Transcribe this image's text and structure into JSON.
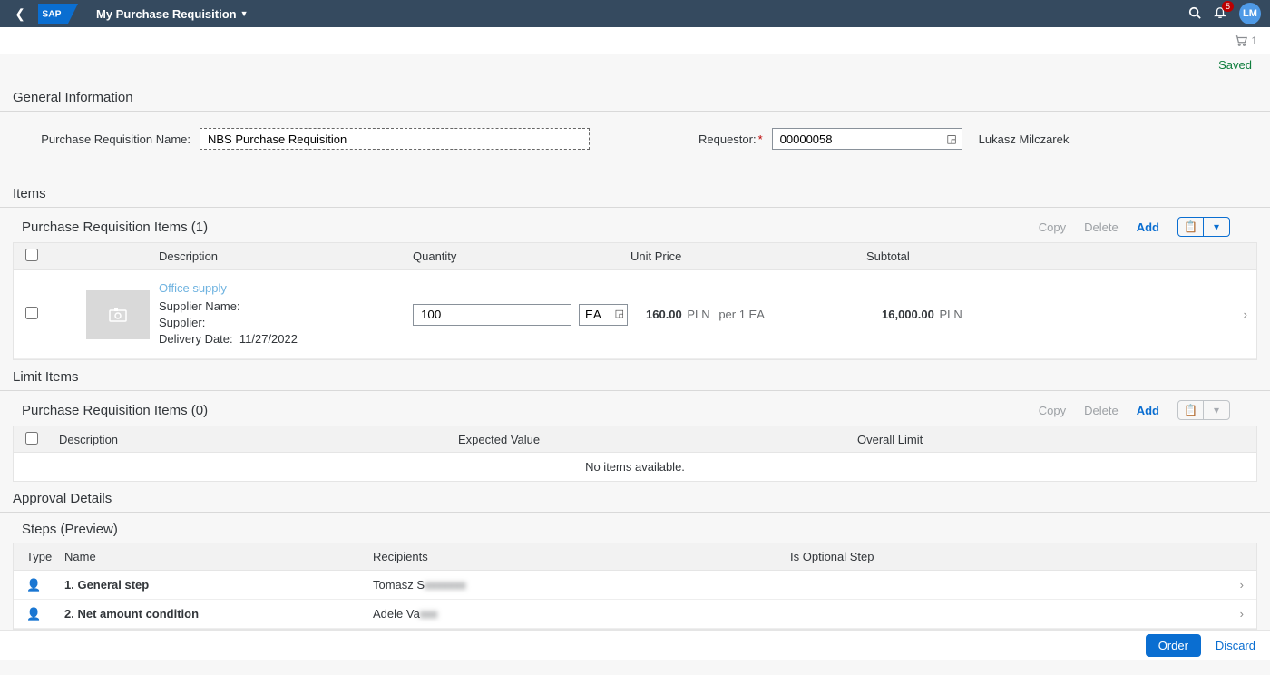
{
  "shell": {
    "app_title": "My Purchase Requisition",
    "notification_count": "5",
    "avatar_initials": "LM",
    "cart_count": "1"
  },
  "status": {
    "saved": "Saved"
  },
  "sections": {
    "general": "General Information",
    "items": "Items",
    "limit": "Limit Items",
    "approval": "Approval Details"
  },
  "general": {
    "pr_name_label": "Purchase Requisition Name:",
    "pr_name_value": "NBS Purchase Requisition",
    "requestor_label": "Requestor:",
    "requestor_value": "00000058",
    "requestor_name": "Lukasz Milczarek"
  },
  "items_panel": {
    "title": "Purchase Requisition Items (1)",
    "copy": "Copy",
    "delete": "Delete",
    "add": "Add",
    "cols": {
      "desc": "Description",
      "qty": "Quantity",
      "unit": "Unit Price",
      "sub": "Subtotal"
    },
    "row": {
      "desc_link": "Office supply",
      "supplier_name_label": "Supplier Name:",
      "supplier_label": "Supplier:",
      "delivery_label": "Delivery Date:",
      "delivery_value": "11/27/2022",
      "qty_value": "100",
      "qty_unit": "EA",
      "price_value": "160.00",
      "price_currency": "PLN",
      "price_per": "per 1 EA",
      "subtotal_value": "16,000.00",
      "subtotal_currency": "PLN"
    }
  },
  "limit_panel": {
    "title": "Purchase Requisition Items (0)",
    "copy": "Copy",
    "delete": "Delete",
    "add": "Add",
    "cols": {
      "desc": "Description",
      "exp": "Expected Value",
      "over": "Overall Limit"
    },
    "empty": "No items available."
  },
  "approval_panel": {
    "title": "Steps (Preview)",
    "cols": {
      "type": "Type",
      "name": "Name",
      "rec": "Recipients",
      "opt": "Is Optional Step"
    },
    "steps": [
      {
        "name": "1. General step",
        "rec_visible": "Tomasz S",
        "rec_blur": "xxxxxxx"
      },
      {
        "name": "2. Net amount condition",
        "rec_visible": "Adele Va",
        "rec_blur": "xxx"
      }
    ]
  },
  "footer": {
    "order": "Order",
    "discard": "Discard"
  }
}
